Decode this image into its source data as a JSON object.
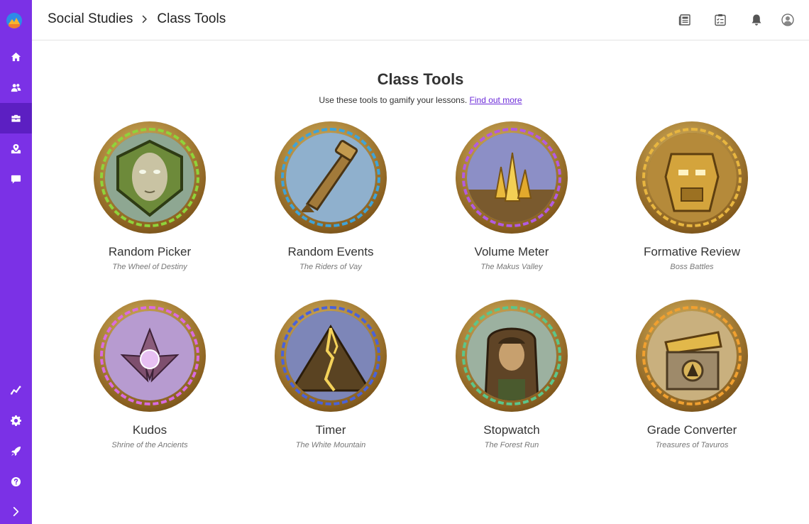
{
  "breadcrumb": {
    "parent": "Social Studies",
    "current": "Class Tools"
  },
  "sidebar": {
    "top_items": [
      {
        "icon": "home-icon"
      },
      {
        "icon": "users-icon"
      },
      {
        "icon": "briefcase-icon",
        "active": true
      },
      {
        "icon": "map-pin-icon"
      },
      {
        "icon": "chat-icon"
      }
    ],
    "bottom_items": [
      {
        "icon": "analytics-icon"
      },
      {
        "icon": "gear-icon"
      },
      {
        "icon": "rocket-icon"
      },
      {
        "icon": "help-icon"
      },
      {
        "icon": "expand-icon"
      }
    ]
  },
  "header_icons": [
    "newspaper-icon",
    "checklist-icon",
    "bell-icon",
    "profile-icon"
  ],
  "page": {
    "title": "Class Tools",
    "subtitle": "Use these tools to gamify your lessons.",
    "link": "Find out more"
  },
  "tools": [
    {
      "name": "Random Picker",
      "subtitle": "The Wheel of Destiny",
      "icon": "mask-face-icon",
      "ring": "#8fd33a"
    },
    {
      "name": "Random Events",
      "subtitle": "The Riders of Vay",
      "icon": "horn-icon",
      "ring": "#3fa3d8"
    },
    {
      "name": "Volume Meter",
      "subtitle": "The Makus Valley",
      "icon": "crystals-icon",
      "ring": "#b25be0"
    },
    {
      "name": "Formative Review",
      "subtitle": "Boss Battles",
      "icon": "golem-icon",
      "ring": "#e8b640"
    },
    {
      "name": "Kudos",
      "subtitle": "Shrine of the Ancients",
      "icon": "lotus-icon",
      "ring": "#d86be0"
    },
    {
      "name": "Timer",
      "subtitle": "The White Mountain",
      "icon": "mountain-icon",
      "ring": "#4a62d8"
    },
    {
      "name": "Stopwatch",
      "subtitle": "The Forest Run",
      "icon": "ranger-icon",
      "ring": "#5cc58a"
    },
    {
      "name": "Grade Converter",
      "subtitle": "Treasures of Tavuros",
      "icon": "treasure-chest-icon",
      "ring": "#f0a030"
    }
  ],
  "colors": {
    "accent": "#7b31e6",
    "accent_active": "#5c1fc2",
    "link": "#6c2bd9"
  }
}
